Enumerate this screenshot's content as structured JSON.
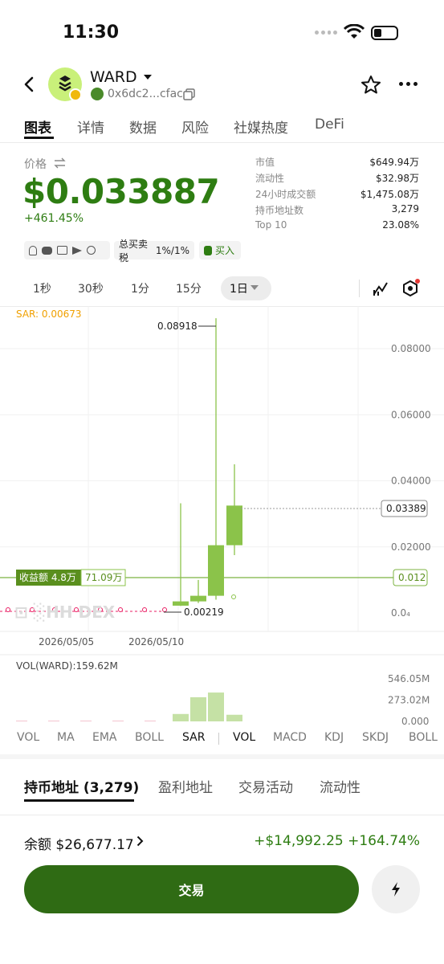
{
  "status_bar": {
    "time": "11:30"
  },
  "header": {
    "token_name": "WARD",
    "address": "0x6dc2...cfac"
  },
  "tabs": [
    {
      "label": "图表",
      "active": true
    },
    {
      "label": "详情"
    },
    {
      "label": "数据"
    },
    {
      "label": "风险"
    },
    {
      "label": "社媒热度"
    },
    {
      "label": "DeFi"
    }
  ],
  "price": {
    "label": "价格",
    "value": "$0.033887",
    "change": "+461.45%"
  },
  "stats": [
    {
      "key": "市值",
      "value": "$649.94万"
    },
    {
      "key": "流动性",
      "value": "$32.98万"
    },
    {
      "key": "24小时成交额",
      "value": "$1,475.08万"
    },
    {
      "key": "持币地址数",
      "value": "3,279"
    },
    {
      "key": "Top 10",
      "value": "23.08%"
    }
  ],
  "chips": {
    "tax_label": "总买卖税",
    "tax_value": "1%/1%",
    "buy_label": "买入"
  },
  "intervals": [
    {
      "label": "1秒"
    },
    {
      "label": "30秒"
    },
    {
      "label": "1分"
    },
    {
      "label": "15分"
    },
    {
      "label": "1日",
      "active": true
    }
  ],
  "chart_data": {
    "type": "candlestick",
    "sar_label": "SAR: 0.00673",
    "y_ticks": [
      "0.08000",
      "0.06000",
      "0.04000",
      "0.02000",
      "0.0₄"
    ],
    "x_ticks": [
      "2026/05/05",
      "2026/05/10"
    ],
    "high_label": "0.08918",
    "low_label": "0.00219",
    "current_price_label": "0.03389",
    "cost_line_label": "0.012",
    "profit_label": "收益额 4.8万",
    "profit_value": "71.09万",
    "watermark": "DEX",
    "candles": [
      {
        "open": 0.0022,
        "close": 0.0035,
        "high": 0.0332,
        "low": 0.0021
      },
      {
        "open": 0.0035,
        "close": 0.0052,
        "high": 0.01,
        "low": 0.003
      },
      {
        "open": 0.0052,
        "close": 0.0205,
        "high": 0.0892,
        "low": 0.004
      },
      {
        "open": 0.0205,
        "close": 0.0325,
        "high": 0.045,
        "low": 0.0175
      }
    ],
    "volume": {
      "label": "VOL(WARD):159.62M",
      "ticks": [
        "546.05M",
        "273.02M",
        "0.000"
      ],
      "values": [
        95,
        310,
        370,
        85
      ]
    },
    "color_up": "#8bc34a",
    "color_line": "#7cb342"
  },
  "indicators": [
    {
      "label": "VOL"
    },
    {
      "label": "MA"
    },
    {
      "label": "EMA"
    },
    {
      "label": "BOLL"
    },
    {
      "label": "SAR",
      "active": true
    },
    {
      "label": "VOL",
      "active": true
    },
    {
      "label": "MACD"
    },
    {
      "label": "KDJ"
    },
    {
      "label": "SKDJ"
    },
    {
      "label": "BOLL"
    }
  ],
  "position_tabs": [
    {
      "label": "持币地址 (3,279)",
      "active": true
    },
    {
      "label": "盈利地址"
    },
    {
      "label": "交易活动"
    },
    {
      "label": "流动性"
    }
  ],
  "balance": {
    "label": "余额 $26,677.17",
    "pnl": "+$14,992.25 +164.74%"
  },
  "trade_button": {
    "label": "交易"
  }
}
